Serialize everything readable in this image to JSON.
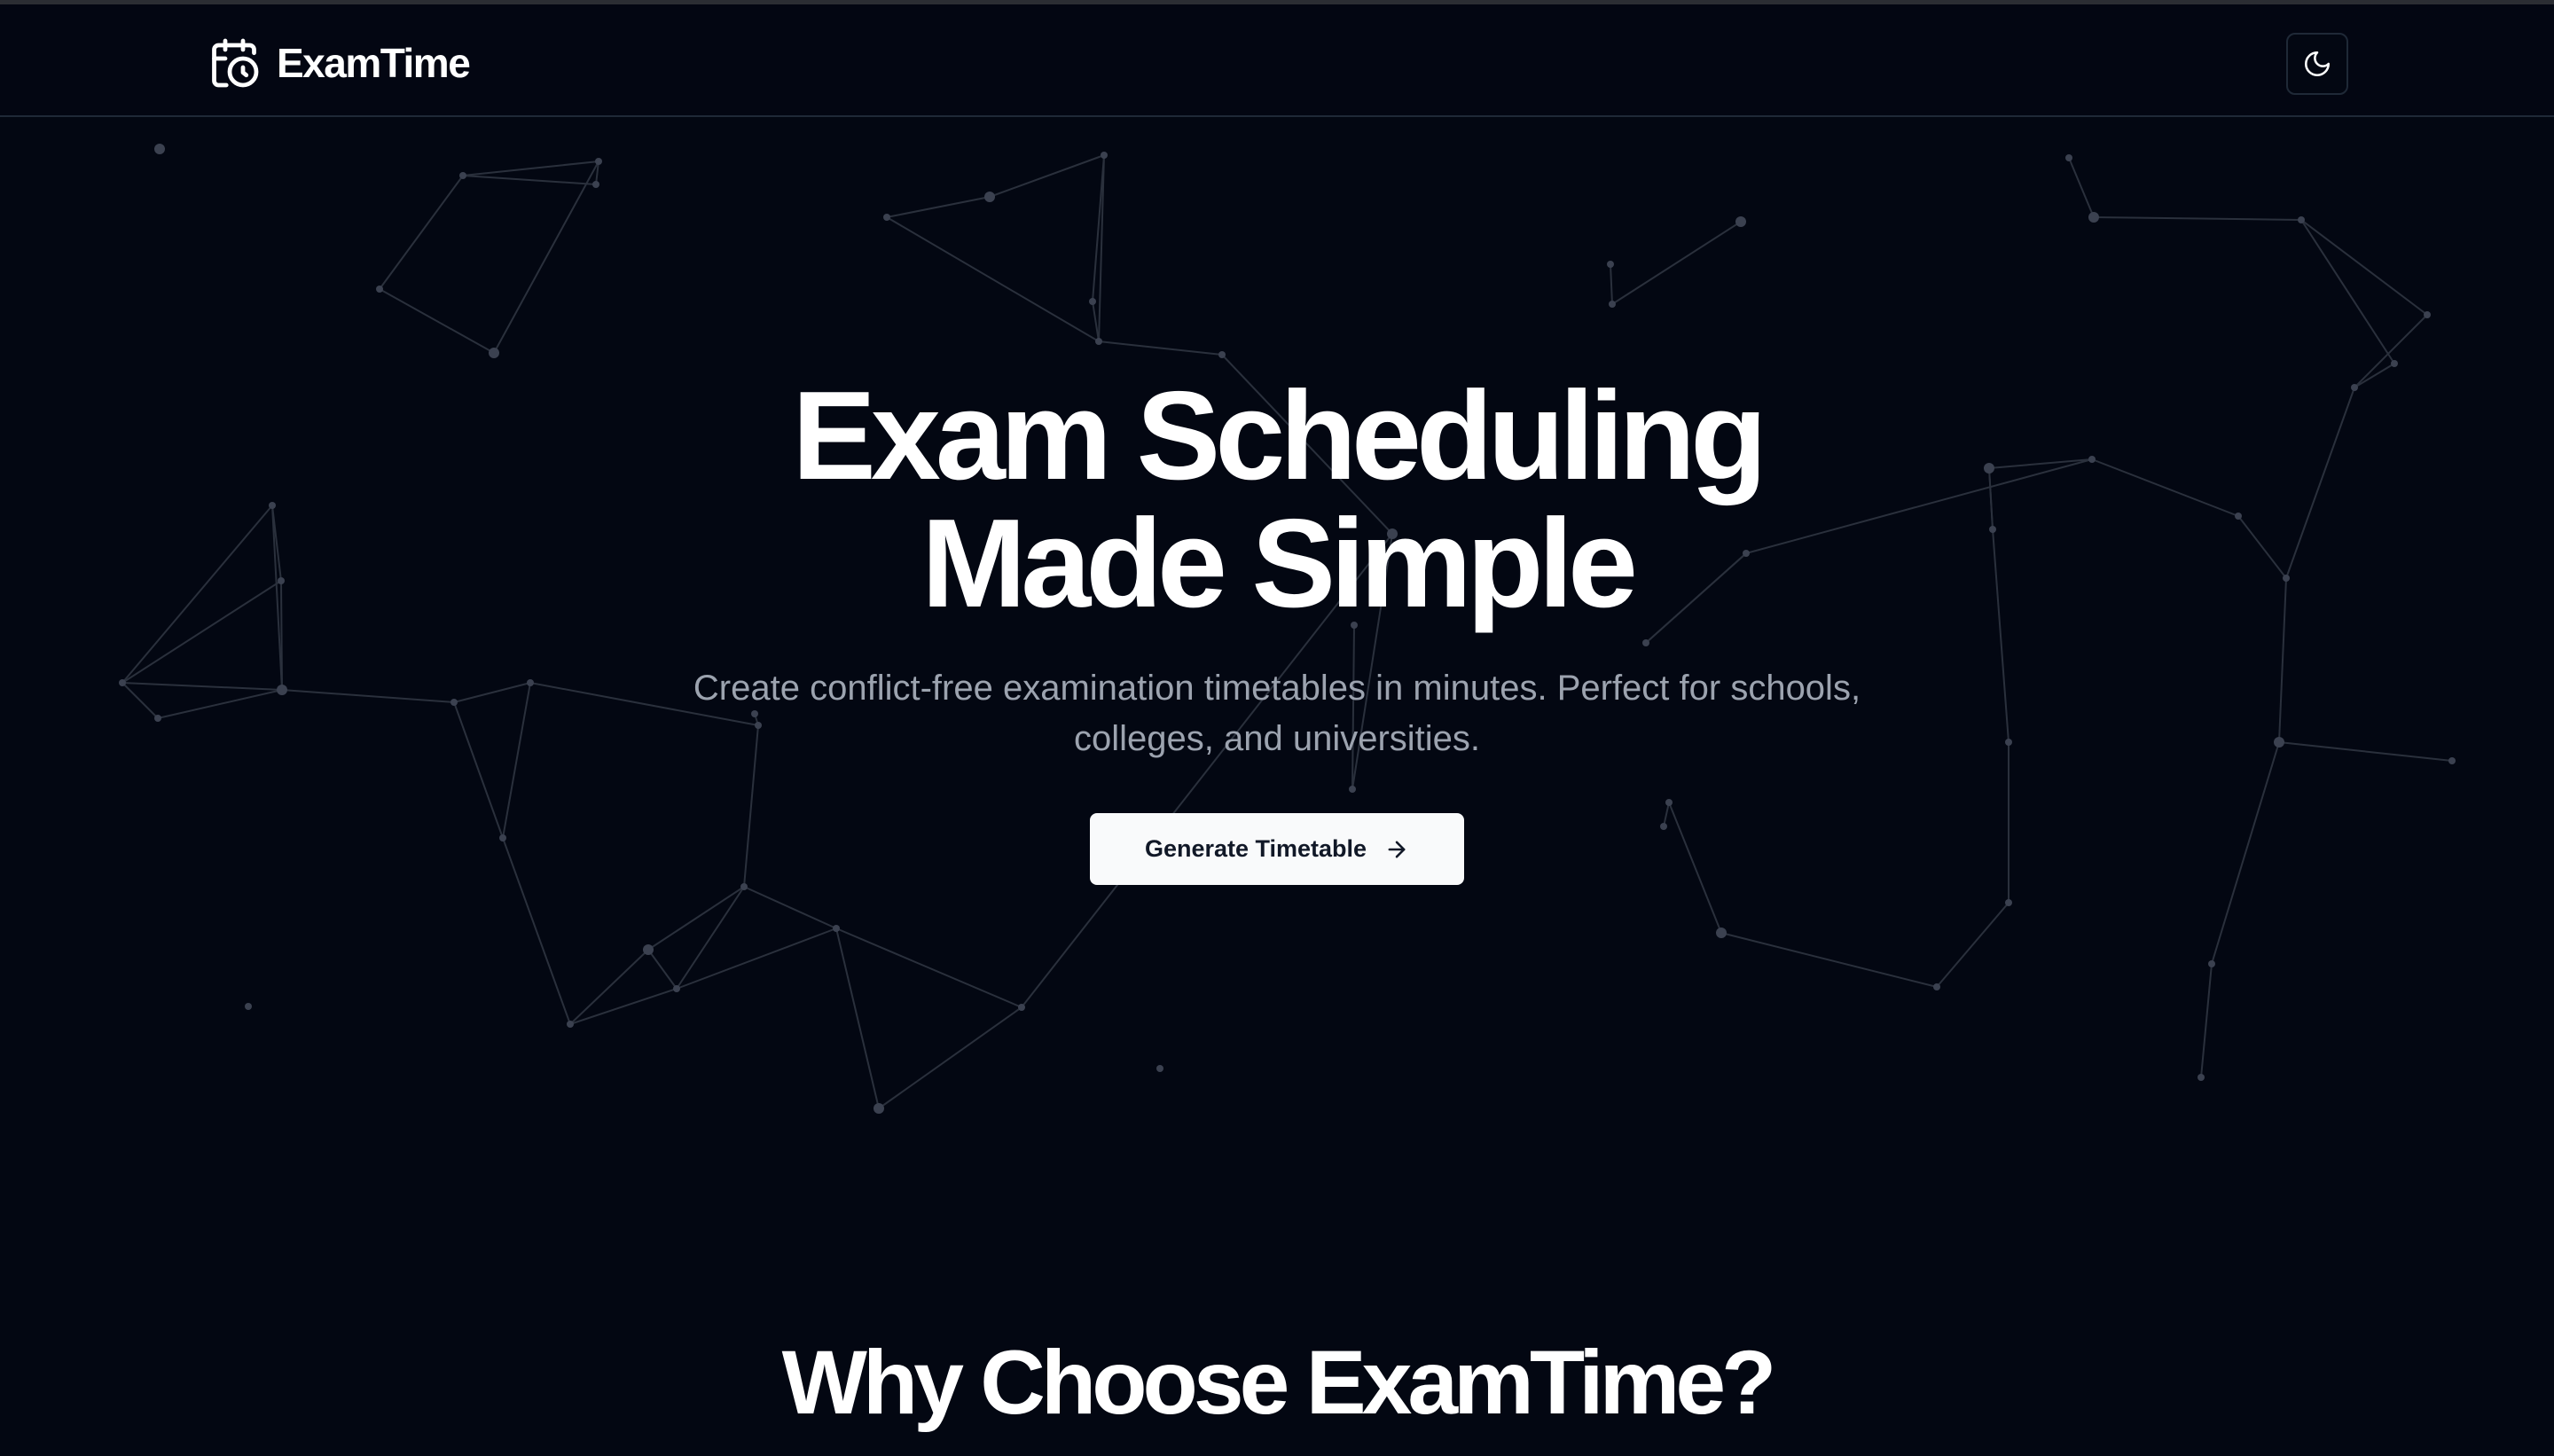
{
  "navbar": {
    "brand_name": "ExamTime",
    "brand_icon": "calendar-clock-icon",
    "theme_toggle_icon": "moon-icon"
  },
  "hero": {
    "title_line1": "Exam Scheduling",
    "title_line2": "Made Simple",
    "subtitle": "Create conflict-free examination timetables in minutes. Perfect for schools, colleges, and universities.",
    "cta_label": "Generate Timetable",
    "cta_icon": "arrow-right-icon"
  },
  "features": {
    "heading": "Why Choose ExamTime?"
  },
  "colors": {
    "background": "#030712",
    "text": "#f9fafb",
    "muted_text": "#9ca3af",
    "border": "#1f2937",
    "network_line": "#2a303c",
    "network_node": "#3b4150"
  }
}
